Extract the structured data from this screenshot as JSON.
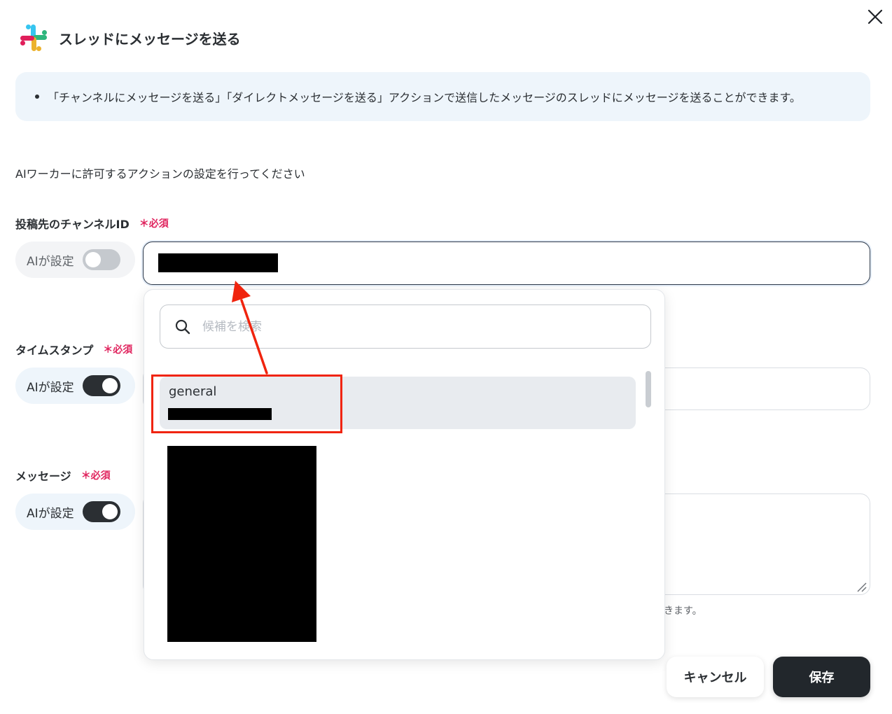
{
  "modal": {
    "title": "スレッドにメッセージを送る",
    "app_icon": "slack-logo",
    "close_icon": "close-icon"
  },
  "info": {
    "items": [
      "「チャンネルにメッセージを送る」「ダイレクトメッセージを送る」アクションで送信したメッセージのスレッドにメッセージを送ることができます。"
    ]
  },
  "description": "AIワーカーに許可するアクションの設定を行ってください",
  "fields": {
    "channel_id": {
      "label": "投稿先のチャンネルID",
      "required": "＊必須",
      "ai_label": "AIが設定",
      "ai_enabled": false,
      "value": "[redacted]"
    },
    "timestamp": {
      "label": "タイムスタンプ",
      "required": "＊必須",
      "ai_label": "AIが設定",
      "ai_enabled": true
    },
    "message": {
      "label": "メッセージ",
      "required": "＊必須",
      "ai_label": "AIが設定",
      "ai_enabled": true,
      "hint": "きます。"
    }
  },
  "dropdown": {
    "search_placeholder": "候補を検索",
    "options": [
      {
        "name": "general",
        "id": "[redacted]",
        "highlighted": true
      }
    ],
    "redacted_list": "[redacted]"
  },
  "footer": {
    "cancel_label": "キャンセル",
    "save_label": "保存"
  },
  "colors": {
    "required": "#e0245e",
    "annotation": "#f0240e",
    "primary_button": "#22272c",
    "info_bg": "#eef5fb"
  }
}
